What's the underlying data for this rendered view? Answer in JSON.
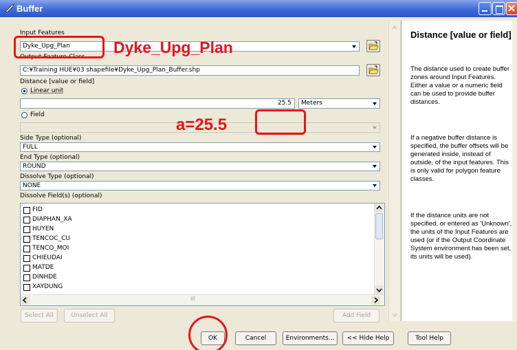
{
  "window": {
    "title": "Buffer",
    "accent_color": "#2b56c9",
    "icon": "wrench-icon"
  },
  "form": {
    "input_features": {
      "label": "Input Features",
      "value": "Dyke_Upg_Plan"
    },
    "output_feature_class": {
      "label": "Output Feature Class",
      "value": "C:¥Training HUE¥03 shapefile¥Dyke_Upg_Plan_Buffer.shp"
    },
    "distance": {
      "label": "Distance [value or field]",
      "linear_unit_label": "Linear unit",
      "linear_unit_selected": true,
      "value": "25.5",
      "unit": "Meters",
      "field_label": "Field",
      "field_value": ""
    },
    "side_type": {
      "label": "Side Type (optional)",
      "value": "FULL"
    },
    "end_type": {
      "label": "End Type (optional)",
      "value": "ROUND"
    },
    "dissolve_type": {
      "label": "Dissolve Type (optional)",
      "value": "NONE"
    },
    "dissolve_fields": {
      "label": "Dissolve Field(s) (optional)",
      "items": [
        "FID",
        "DIAPHAN_XA",
        "HUYEN",
        "TENCOC_CU",
        "TENCO_MOI",
        "CHIEUDAI",
        "MATDE",
        "DINHDE",
        "XAYDUNG"
      ],
      "hscroll_marker": "III"
    },
    "buttons": {
      "select_all": "Select All",
      "unselect_all": "Unselect All",
      "add_field": "Add Field"
    }
  },
  "help": {
    "title": "Distance [value or field]",
    "paragraphs": [
      "The distance used to create buffer zones around Input Features. Either a value or a numeric field can be used to provide buffer distances.",
      "If a negative buffer distance is specified, the buffer offsets will be generated inside, instead of outside, of the input features. This is only valid for polygon feature classes.",
      "If the distance units are not specified, or entered as 'Unknown', the units of the Input Features are used (or if the Output Coordinate System environment has been set, its units will be used)."
    ]
  },
  "footer": {
    "ok": "OK",
    "cancel": "Cancel",
    "environments": "Environments...",
    "hide_help": "<< Hide Help",
    "tool_help": "Tool Help"
  },
  "annotations": {
    "input_label": "Dyke_Upg_Plan",
    "distance_label": "a=25.5",
    "color": "#e8141a"
  }
}
